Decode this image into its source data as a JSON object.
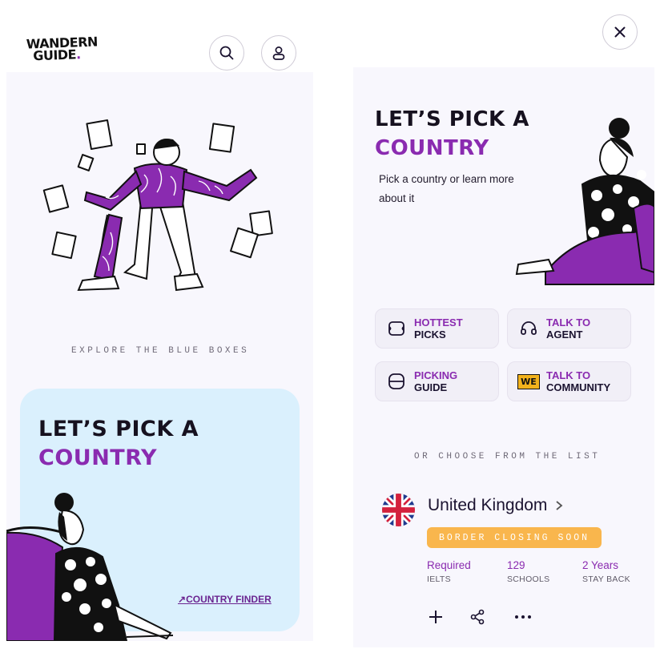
{
  "left_screen": {
    "logo_line1": "WANDERN",
    "logo_line2": "GUIDE",
    "logo_dot": ".",
    "caption": "EXPLORE THE BLUE BOXES",
    "card": {
      "title_line1": "LET’S PICK A",
      "title_line2": "COUNTRY",
      "finder_link": "COUNTRY FINDER"
    },
    "icons": [
      "search-icon",
      "user-icon",
      "arrow-up-right-icon"
    ]
  },
  "right_screen": {
    "title_line1": "LET’S PICK A",
    "title_line2": "COUNTRY",
    "subtitle": "Pick a country or learn more about it",
    "tiles": [
      {
        "line1": "HOTTEST",
        "line2": "PICKS",
        "icon": "ticket-icon"
      },
      {
        "line1": "TALK TO",
        "line2": "AGENT",
        "icon": "headset-icon"
      },
      {
        "line1": "PICKING",
        "line2": "GUIDE",
        "icon": "guide-icon"
      },
      {
        "line1": "TALK TO",
        "line2": "COMMUNITY",
        "icon": "we-community-icon",
        "icon_text": "WE"
      }
    ],
    "list_caption": "OR CHOOSE FROM THE LIST",
    "country": {
      "name": "United Kingdom",
      "badge": "BORDER CLOSING SOON",
      "stats": [
        {
          "value": "Required",
          "label": "IELTS"
        },
        {
          "value": "129",
          "label": "SCHOOLS"
        },
        {
          "value": "2 Years",
          "label": "STAY BACK"
        }
      ]
    },
    "icons": [
      "close-icon",
      "chevron-right-icon",
      "plus-icon",
      "share-icon",
      "more-icon",
      "uk-flag-icon"
    ]
  },
  "colors": {
    "accent_purple": "#8a2bb0",
    "card_blue": "#daf0fd",
    "badge_orange": "#f9b64d",
    "panel_bg": "#f8f7fd"
  }
}
